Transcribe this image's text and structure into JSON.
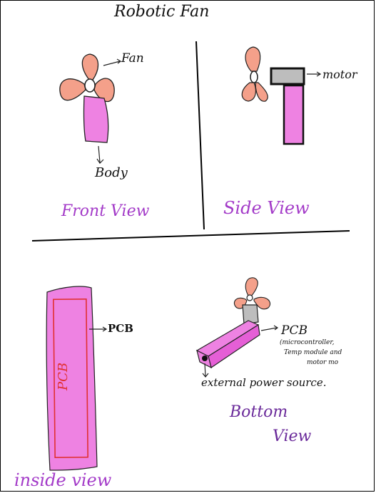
{
  "title": "Robotic Fan",
  "front_view": {
    "caption": "Front View",
    "label_fan": "Fan",
    "label_body": "Body"
  },
  "side_view": {
    "caption": "Side View",
    "label_motor": "motor"
  },
  "inside_view": {
    "caption": "inside view",
    "label_pcb_outside": "PCB",
    "label_pcb_inside": "PCB"
  },
  "bottom_view": {
    "caption_line1": "Bottom",
    "caption_line2": "View",
    "label_pcb": "PCB",
    "pcb_note_line1": "(microcontroller,",
    "pcb_note_line2": "Temp module and",
    "pcb_note_line3": "motor mo",
    "label_power": "external power source."
  },
  "colors": {
    "body_pink": "#ee82e2",
    "body_pink_dark": "#e55fd6",
    "blade_salmon": "#f4a08a",
    "caption_purple": "#a33ac8",
    "motor_gray": "#bdbdbd",
    "pcb_red": "#e03030"
  }
}
